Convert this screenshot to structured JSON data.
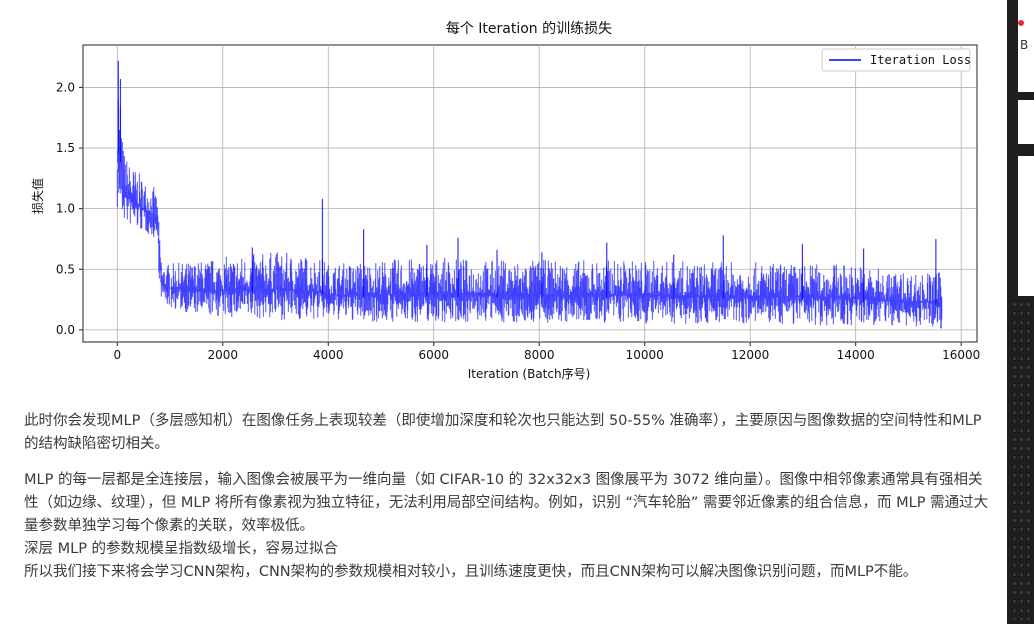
{
  "chart_data": {
    "type": "line",
    "title": "每个 Iteration 的训练损失",
    "xlabel": "Iteration (Batch序号)",
    "ylabel": "损失值",
    "xlim": [
      -650,
      16300
    ],
    "ylim": [
      -0.1,
      2.35
    ],
    "xticks": [
      0,
      2000,
      4000,
      6000,
      8000,
      10000,
      12000,
      14000,
      16000
    ],
    "yticks": [
      0.0,
      0.5,
      1.0,
      1.5,
      2.0
    ],
    "xtick_labels": [
      "0",
      "2000",
      "4000",
      "6000",
      "8000",
      "10000",
      "12000",
      "14000",
      "16000"
    ],
    "ytick_labels": [
      "0.0",
      "0.5",
      "1.0",
      "1.5",
      "2.0"
    ],
    "grid": true,
    "legend_position": "top-right",
    "series": [
      {
        "name": "Iteration Loss",
        "color": "#0000ff",
        "x": [
          0,
          20,
          40,
          60,
          80,
          100,
          150,
          200,
          300,
          400,
          500,
          600,
          700,
          760,
          800,
          850,
          1000,
          1500,
          2000,
          3000,
          3900,
          4000,
          5000,
          6000,
          7000,
          8000,
          9000,
          10000,
          11000,
          12000,
          13000,
          14000,
          14500,
          15000,
          15600,
          15640
        ],
        "upper": [
          1.75,
          2.22,
          1.8,
          2.07,
          1.75,
          1.55,
          1.45,
          1.4,
          1.35,
          1.3,
          1.25,
          1.2,
          1.18,
          1.1,
          0.8,
          0.55,
          0.55,
          0.57,
          0.6,
          0.65,
          0.6,
          0.55,
          0.58,
          0.6,
          0.58,
          0.58,
          0.58,
          0.58,
          0.56,
          0.56,
          0.55,
          0.55,
          0.5,
          0.48,
          0.48,
          0.4
        ],
        "lower": [
          0.97,
          0.95,
          0.95,
          0.93,
          0.92,
          0.9,
          0.88,
          0.86,
          0.84,
          0.82,
          0.8,
          0.78,
          0.75,
          0.72,
          0.35,
          0.22,
          0.18,
          0.12,
          0.1,
          0.08,
          0.08,
          0.08,
          0.06,
          0.06,
          0.06,
          0.05,
          0.05,
          0.05,
          0.05,
          0.05,
          0.04,
          0.03,
          0.03,
          0.02,
          0.02,
          0.0
        ],
        "spikes": [
          {
            "x": 20,
            "y": 2.22
          },
          {
            "x": 60,
            "y": 2.07
          },
          {
            "x": 3890,
            "y": 1.08
          },
          {
            "x": 6460,
            "y": 0.76
          },
          {
            "x": 5870,
            "y": 0.7
          },
          {
            "x": 4670,
            "y": 0.83
          },
          {
            "x": 11490,
            "y": 0.78
          },
          {
            "x": 15520,
            "y": 0.75
          },
          {
            "x": 9280,
            "y": 0.72
          },
          {
            "x": 12990,
            "y": 0.71
          },
          {
            "x": 7200,
            "y": 0.66
          },
          {
            "x": 14150,
            "y": 0.67
          },
          {
            "x": 8050,
            "y": 0.64
          },
          {
            "x": 10550,
            "y": 0.62
          },
          {
            "x": 2560,
            "y": 0.68
          }
        ]
      }
    ]
  },
  "article": {
    "p1": "此时你会发现MLP（多层感知机）在图像任务上表现较差（即使增加深度和轮次也只能达到 50-55% 准确率），主要原因与图像数据的空间特性和MLP 的结构缺陷密切相关。",
    "p2": "MLP 的每一层都是全连接层，输入图像会被展平为一维向量（如 CIFAR-10 的 32x32x3 图像展平为 3072 维向量）。图像中相邻像素通常具有强相关性（如边缘、纹理），但 MLP 将所有像素视为独立特征，无法利用局部空间结构。例如，识别 “汽车轮胎” 需要邻近像素的组合信息，而 MLP 需通过大量参数单独学习每个像素的关联，效率极低。",
    "p3": "深层 MLP 的参数规模呈指数级增长，容易过拟合",
    "p4": "所以我们接下来将会学习CNN架构，CNN架构的参数规模相对较小，且训练速度更快，而且CNN架构可以解决图像识别问题，而MLP不能。"
  },
  "side_panel": {
    "letter_1": "B"
  }
}
